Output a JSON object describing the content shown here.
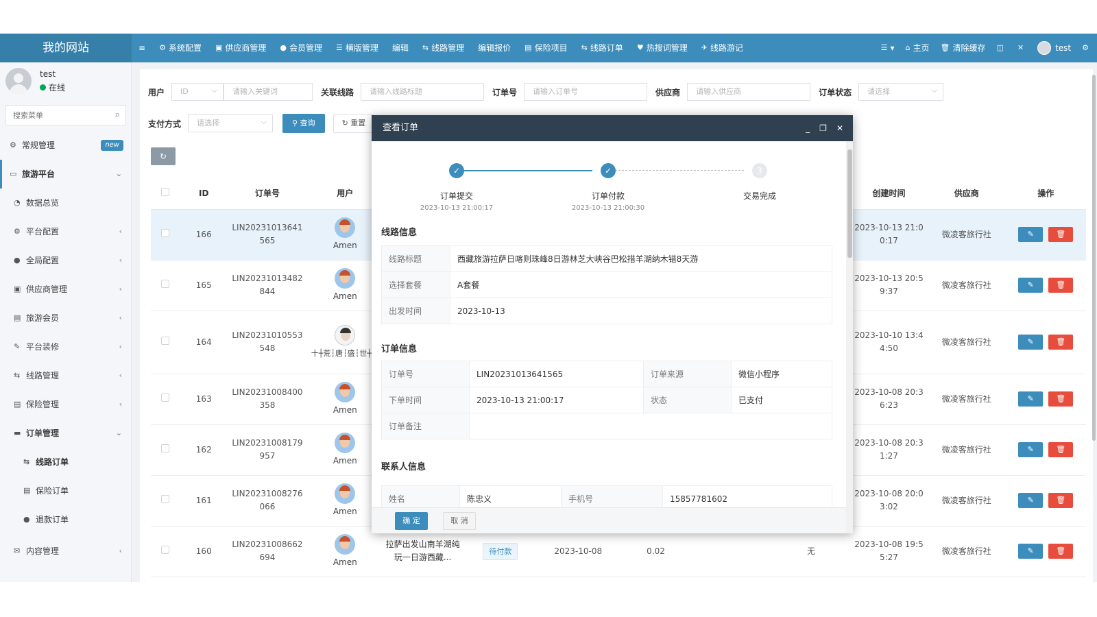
{
  "header": {
    "logo": "我的网站",
    "menu_toggle": "≡",
    "nav": [
      {
        "icon": "⚙",
        "label": "系统配置"
      },
      {
        "icon": "▣",
        "label": "供应商管理"
      },
      {
        "icon": "●",
        "label": "会员管理"
      },
      {
        "icon": "☰",
        "label": "横版管理"
      },
      {
        "icon": "",
        "label": "编辑"
      },
      {
        "icon": "⇆",
        "label": "线路管理"
      },
      {
        "icon": "",
        "label": "编辑报价"
      },
      {
        "icon": "▤",
        "label": "保险项目"
      },
      {
        "icon": "⇆",
        "label": "线路订单"
      },
      {
        "icon": "♥",
        "label": "热搜词管理"
      },
      {
        "icon": "✈",
        "label": "线路游记"
      }
    ],
    "right": [
      {
        "icon": "☰",
        "label": "▾"
      },
      {
        "icon": "⌂",
        "label": "主页"
      },
      {
        "icon": "🗑",
        "label": "清除缓存"
      },
      {
        "icon": "◫",
        "label": ""
      },
      {
        "icon": "✕",
        "label": ""
      }
    ],
    "user": "test",
    "gear": "⚙"
  },
  "sidebar": {
    "user_name": "test",
    "user_status": "在线",
    "search_placeholder": "搜索菜单",
    "badge": "new",
    "items": [
      {
        "icon": "⚙",
        "label": "常规管理",
        "arrow": ""
      },
      {
        "icon": "▭",
        "label": "旅游平台",
        "arrow": "⌄"
      },
      {
        "icon": "◔",
        "label": "数据总览",
        "arrow": ""
      },
      {
        "icon": "⚙",
        "label": "平台配置",
        "arrow": "‹"
      },
      {
        "icon": "●",
        "label": "全局配置",
        "arrow": "‹"
      },
      {
        "icon": "▣",
        "label": "供应商管理",
        "arrow": "‹"
      },
      {
        "icon": "▤",
        "label": "旅游会员",
        "arrow": "‹"
      },
      {
        "icon": "✎",
        "label": "平台装修",
        "arrow": "‹"
      },
      {
        "icon": "⇆",
        "label": "线路管理",
        "arrow": "‹"
      },
      {
        "icon": "▤",
        "label": "保险管理",
        "arrow": "‹"
      },
      {
        "icon": "▬",
        "label": "订单管理",
        "arrow": "⌄"
      },
      {
        "icon": "⇆",
        "label": "线路订单",
        "arrow": ""
      },
      {
        "icon": "▤",
        "label": "保险订单",
        "arrow": ""
      },
      {
        "icon": "●",
        "label": "退款订单",
        "arrow": ""
      },
      {
        "icon": "✉",
        "label": "内容管理",
        "arrow": "‹"
      }
    ]
  },
  "filters": {
    "user_label": "用户",
    "user_select": "ID",
    "user_placeholder": "请输入关键词",
    "route_label": "关联线路",
    "route_placeholder": "请输入线路标题",
    "order_label": "订单号",
    "order_placeholder": "请输入订单号",
    "supplier_label": "供应商",
    "supplier_placeholder": "请输入供应商",
    "status_label": "订单状态",
    "status_placeholder": "请选择",
    "pay_label": "支付方式",
    "pay_placeholder": "请选择",
    "query_btn": "查询",
    "reset_btn": "重置",
    "query_icon": "⚲",
    "reset_icon": "↻",
    "refresh_icon": "↻"
  },
  "table": {
    "headers": {
      "id": "ID",
      "order": "订单号",
      "user": "用户",
      "created": "创建时间",
      "supplier": "供应商",
      "ops": "操作"
    },
    "rows": [
      {
        "id": "166",
        "order": "LIN20231013641 565",
        "user": "Amen",
        "created": "2023-10-13 21:0 0:17",
        "supplier": "微凌客旅行社"
      },
      {
        "id": "165",
        "order": "LIN20231013482 844",
        "user": "Amen",
        "created": "2023-10-13 20:5 9:37",
        "supplier": "微凌客旅行社"
      },
      {
        "id": "164",
        "order": "LIN20231010553 548",
        "user": "十┼荒┆唐┆盛┆世┼十",
        "created": "2023-10-10 13:4 4:50",
        "supplier": "微凌客旅行社"
      },
      {
        "id": "163",
        "order": "LIN20231008400 358",
        "user": "Amen",
        "created": "2023-10-08 20:3 6:23",
        "supplier": "微凌客旅行社"
      },
      {
        "id": "162",
        "order": "LIN20231008179 957",
        "user": "Amen",
        "created": "2023-10-08 20:3 1:27",
        "supplier": "微凌客旅行社"
      },
      {
        "id": "161",
        "order": "LIN20231008276 066",
        "user": "Amen",
        "created": "2023-10-08 20:0 3:02",
        "supplier": "微凌客旅行社"
      },
      {
        "id": "160",
        "order": "LIN20231008662 694",
        "user": "Amen",
        "created": "2023-10-08 19:5 5:27",
        "supplier": "微凌客旅行社"
      }
    ],
    "row160": {
      "route": "拉萨出发山南羊湖纯玩一日游西藏...",
      "status": "待付款",
      "date": "2023-10-08",
      "amount": "0.02",
      "extra": "无"
    },
    "edit_icon": "✎",
    "delete_icon": "🗑"
  },
  "modal": {
    "title": "查看订单",
    "controls": {
      "min": "_",
      "max": "❐",
      "close": "✕"
    },
    "steps": [
      {
        "label": "订单提交",
        "time": "2023-10-13 21:00:17",
        "mark": "✓"
      },
      {
        "label": "订单付款",
        "time": "2023-10-13 21:00:30",
        "mark": "✓"
      },
      {
        "label": "交易完成",
        "time": "",
        "mark": "3"
      }
    ],
    "route_section": "线路信息",
    "route_info": [
      {
        "key": "线路标题",
        "value": "西藏旅游拉萨日喀则珠峰8日游林芝大峡谷巴松措羊湖纳木错8天游"
      },
      {
        "key": "选择套餐",
        "value": "A套餐"
      },
      {
        "key": "出发时间",
        "value": "2023-10-13"
      }
    ],
    "order_section": "订单信息",
    "order_info": {
      "order_no_key": "订单号",
      "order_no": "LIN20231013641565",
      "source_key": "订单来源",
      "source": "微信小程序",
      "time_key": "下单时间",
      "time": "2023-10-13 21:00:17",
      "status_key": "状态",
      "status": "已支付",
      "remark_key": "订单备注",
      "remark": ""
    },
    "contact_section": "联系人信息",
    "contact": {
      "name_key": "姓名",
      "name": "陈忠义",
      "phone_key": "手机号",
      "phone": "15857781602"
    },
    "ok": "确 定",
    "cancel": "取 消"
  }
}
